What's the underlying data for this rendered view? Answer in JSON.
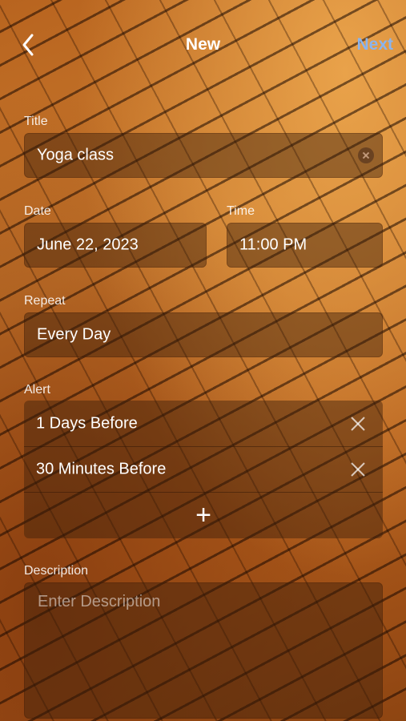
{
  "nav": {
    "title": "New",
    "next_label": "Next",
    "back_icon": "chevron-left-icon"
  },
  "form": {
    "title_label": "Title",
    "title_value": "Yoga class",
    "date_label": "Date",
    "date_value": "June 22, 2023",
    "time_label": "Time",
    "time_value": "11:00 PM",
    "repeat_label": "Repeat",
    "repeat_value": "Every Day",
    "alert_label": "Alert",
    "alerts": [
      {
        "label": "1 Days Before"
      },
      {
        "label": "30 Minutes Before"
      }
    ],
    "add_alert_symbol": "+",
    "description_label": "Description",
    "description_placeholder": "Enter Description"
  },
  "colors": {
    "accent_next": "#8ab4ee",
    "field_bg": "rgba(60,30,10,0.45)"
  }
}
